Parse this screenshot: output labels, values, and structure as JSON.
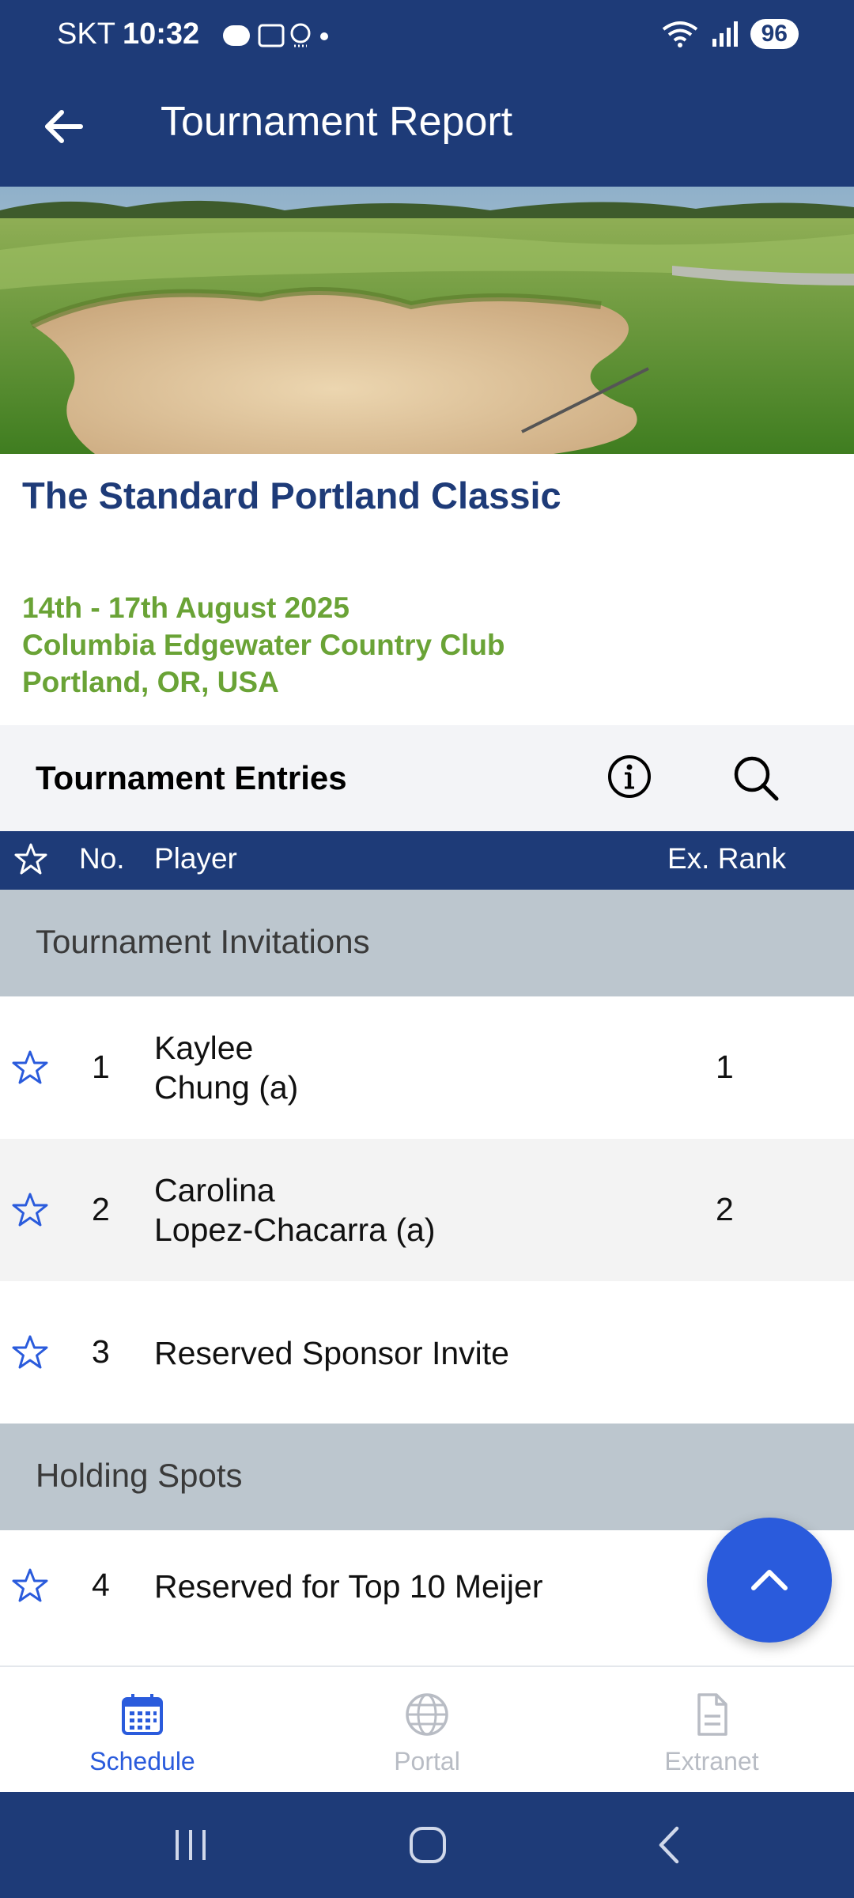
{
  "status_bar": {
    "carrier": "SKT",
    "time": "10:32",
    "battery": "96",
    "icons": [
      "line-icon",
      "screenshot-icon",
      "search-app-icon",
      "dot-icon",
      "wifi-icon",
      "signal-icon"
    ]
  },
  "app_bar": {
    "title": "Tournament Report",
    "back_icon": "arrow-left-icon"
  },
  "tournament": {
    "name": "The Standard Portland Classic",
    "date": "14th - 17th August 2025",
    "club": "Columbia Edgewater Country Club",
    "city": "Portland, OR, USA"
  },
  "entries": {
    "title": "Tournament Entries",
    "columns": {
      "number": "No.",
      "player": "Player",
      "rank": "Ex. Rank"
    },
    "sections": [
      {
        "title": "Tournament Invitations",
        "rows": [
          {
            "no": "1",
            "first": "Kaylee",
            "last": "Chung (a)",
            "rank": "1"
          },
          {
            "no": "2",
            "first": "Carolina",
            "last": "Lopez-Chacarra (a)",
            "rank": "2"
          },
          {
            "no": "3",
            "name": "Reserved Sponsor Invite",
            "rank": ""
          }
        ]
      },
      {
        "title": "Holding Spots",
        "rows": [
          {
            "no": "4",
            "name": "Reserved for Top 10 Meijer",
            "rank": ""
          }
        ]
      }
    ]
  },
  "bottom_nav": {
    "items": [
      {
        "label": "Schedule",
        "icon": "calendar-icon",
        "active": true
      },
      {
        "label": "Portal",
        "icon": "globe-icon",
        "active": false
      },
      {
        "label": "Extranet",
        "icon": "document-icon",
        "active": false
      }
    ]
  },
  "colors": {
    "primary": "#1e3b78",
    "accent_green": "#6aa336",
    "fab": "#2a5bdc",
    "section_bg": "#bcc6ce"
  }
}
